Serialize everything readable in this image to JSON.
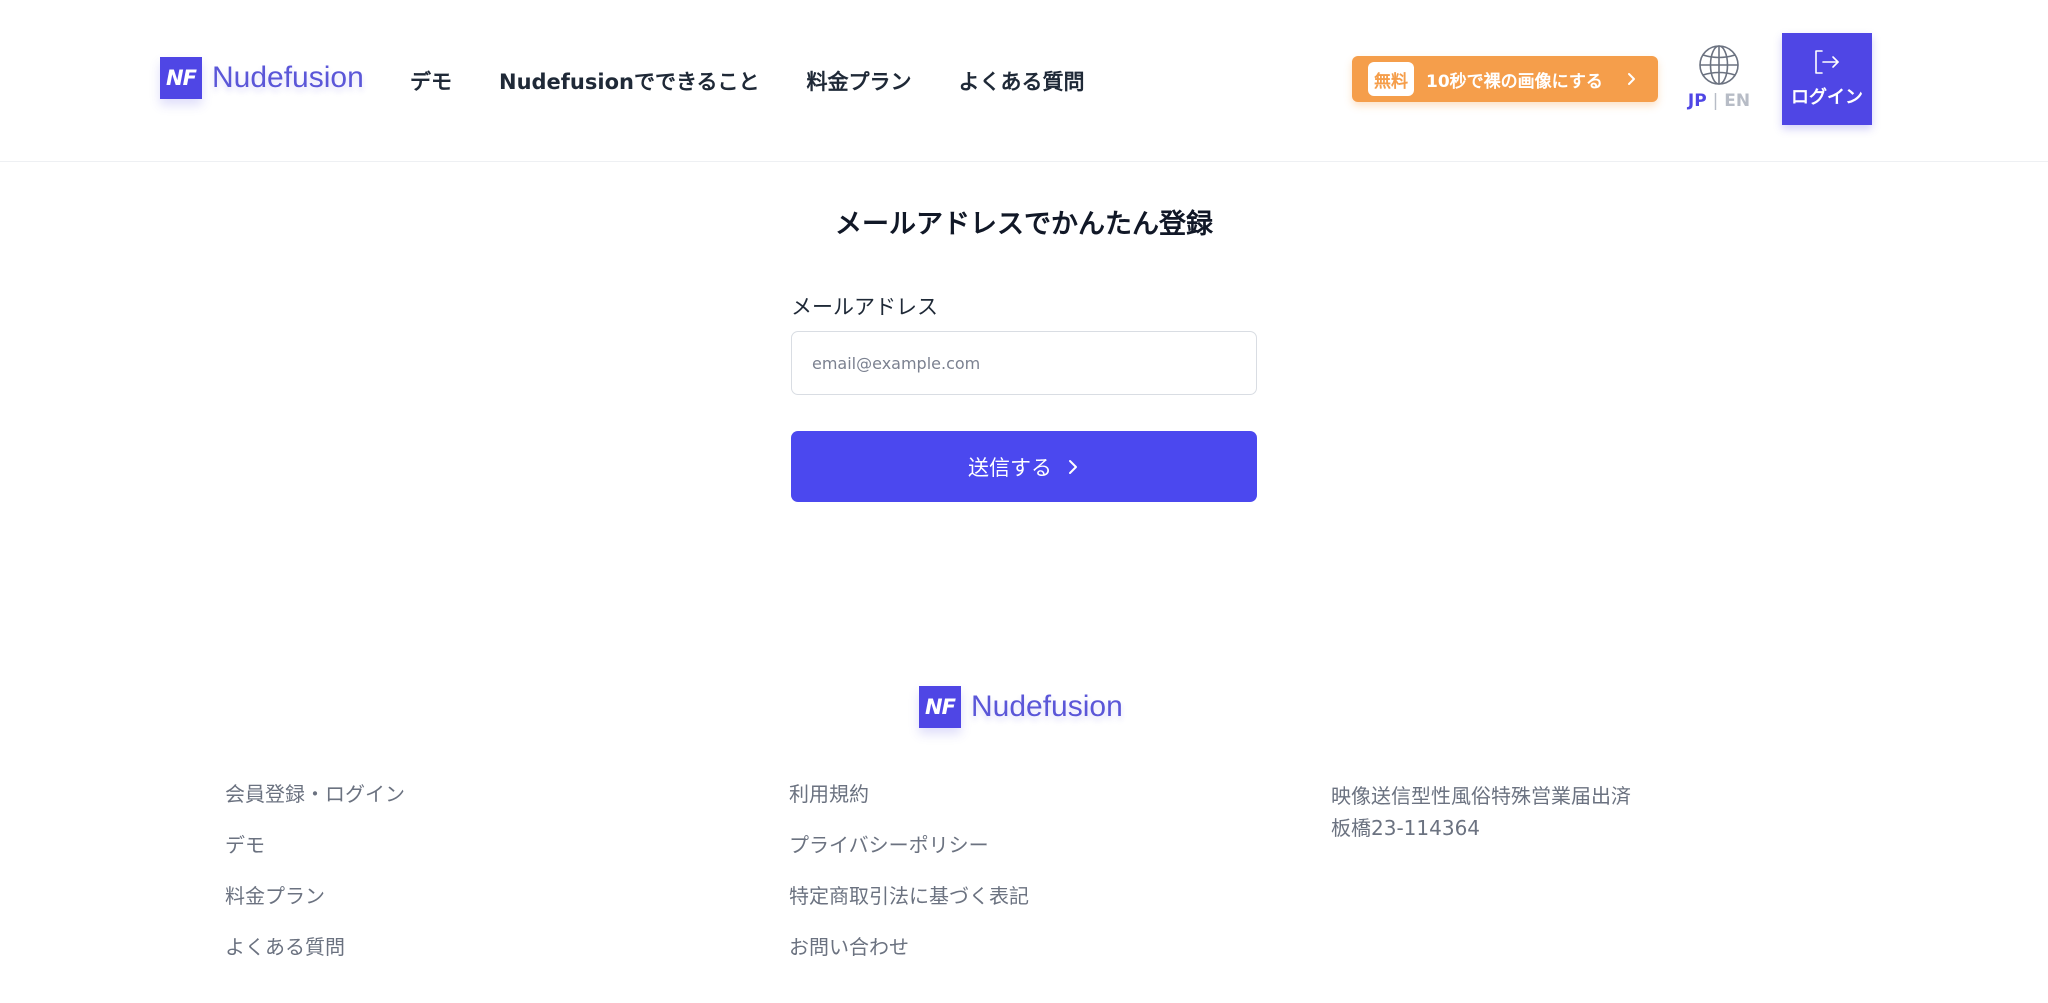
{
  "header": {
    "logo": {
      "mark": "NF",
      "name": "Nudefusion"
    },
    "nav": [
      {
        "label": "デモ"
      },
      {
        "label": "Nudefusionでできること"
      },
      {
        "label": "料金プラン"
      },
      {
        "label": "よくある質問"
      }
    ],
    "cta": {
      "badge": "無料",
      "label": "10秒で裸の画像にする",
      "icon": "chevron-right-icon"
    },
    "language": {
      "jp": "JP",
      "separator": "|",
      "en": "EN",
      "active": "JP",
      "icon": "globe-icon"
    },
    "login": {
      "label": "ログイン",
      "icon": "login-icon"
    }
  },
  "form": {
    "title": "メールアドレスでかんたん登録",
    "email_label": "メールアドレス",
    "email_placeholder": "email@example.com",
    "email_value": "",
    "submit_label": "送信する"
  },
  "footer": {
    "logo": {
      "mark": "NF",
      "name": "Nudefusion"
    },
    "col1": [
      {
        "label": "会員登録・ログイン"
      },
      {
        "label": "デモ"
      },
      {
        "label": "料金プラン"
      },
      {
        "label": "よくある質問"
      }
    ],
    "col2": [
      {
        "label": "利用規約"
      },
      {
        "label": "プライバシーポリシー"
      },
      {
        "label": "特定商取引法に基づく表記"
      },
      {
        "label": "お問い合わせ"
      }
    ],
    "license": {
      "line1": "映像送信型性風俗特殊営業届出済",
      "line2": "板橋23-114364"
    }
  },
  "colors": {
    "brand": "#4f46e5",
    "button": "#4b48ef",
    "cta": "#f59e4b",
    "muted_text": "#6b7280"
  }
}
